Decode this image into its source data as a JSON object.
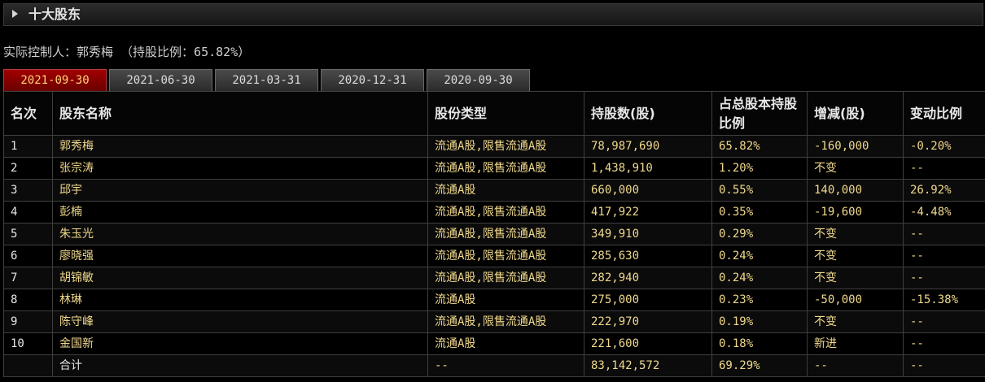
{
  "panel": {
    "title": "十大股东"
  },
  "controller": {
    "text": "实际控制人：郭秀梅 （持股比例：65.82%）"
  },
  "tabs": [
    {
      "label": "2021-09-30",
      "active": true
    },
    {
      "label": "2021-06-30",
      "active": false
    },
    {
      "label": "2021-03-31",
      "active": false
    },
    {
      "label": "2020-12-31",
      "active": false
    },
    {
      "label": "2020-09-30",
      "active": false
    }
  ],
  "table": {
    "headers": [
      "名次",
      "股东名称",
      "股份类型",
      "持股数(股)",
      "占总股本持股比例",
      "增减(股)",
      "变动比例"
    ],
    "rows": [
      [
        "1",
        "郭秀梅",
        "流通A股,限售流通A股",
        "78,987,690",
        "65.82%",
        "-160,000",
        "-0.20%"
      ],
      [
        "2",
        "张宗涛",
        "流通A股,限售流通A股",
        "1,438,910",
        "1.20%",
        "不变",
        "--"
      ],
      [
        "3",
        "邱宇",
        "流通A股",
        "660,000",
        "0.55%",
        "140,000",
        "26.92%"
      ],
      [
        "4",
        "彭楠",
        "流通A股,限售流通A股",
        "417,922",
        "0.35%",
        "-19,600",
        "-4.48%"
      ],
      [
        "5",
        "朱玉光",
        "流通A股,限售流通A股",
        "349,910",
        "0.29%",
        "不变",
        "--"
      ],
      [
        "6",
        "廖晓强",
        "流通A股,限售流通A股",
        "285,630",
        "0.24%",
        "不变",
        "--"
      ],
      [
        "7",
        "胡锦敏",
        "流通A股,限售流通A股",
        "282,940",
        "0.24%",
        "不变",
        "--"
      ],
      [
        "8",
        "林琳",
        "流通A股",
        "275,000",
        "0.23%",
        "-50,000",
        "-15.38%"
      ],
      [
        "9",
        "陈守峰",
        "流通A股,限售流通A股",
        "222,970",
        "0.19%",
        "不变",
        "--"
      ],
      [
        "10",
        "金国新",
        "流通A股",
        "221,600",
        "0.18%",
        "新进",
        "--"
      ]
    ],
    "total": [
      "",
      "合计",
      "--",
      "83,142,572",
      "69.29%",
      "--",
      "--"
    ]
  },
  "colors": {
    "background": "#000000",
    "active_tab": "#8b0000",
    "value_text": "#f0d98c"
  }
}
